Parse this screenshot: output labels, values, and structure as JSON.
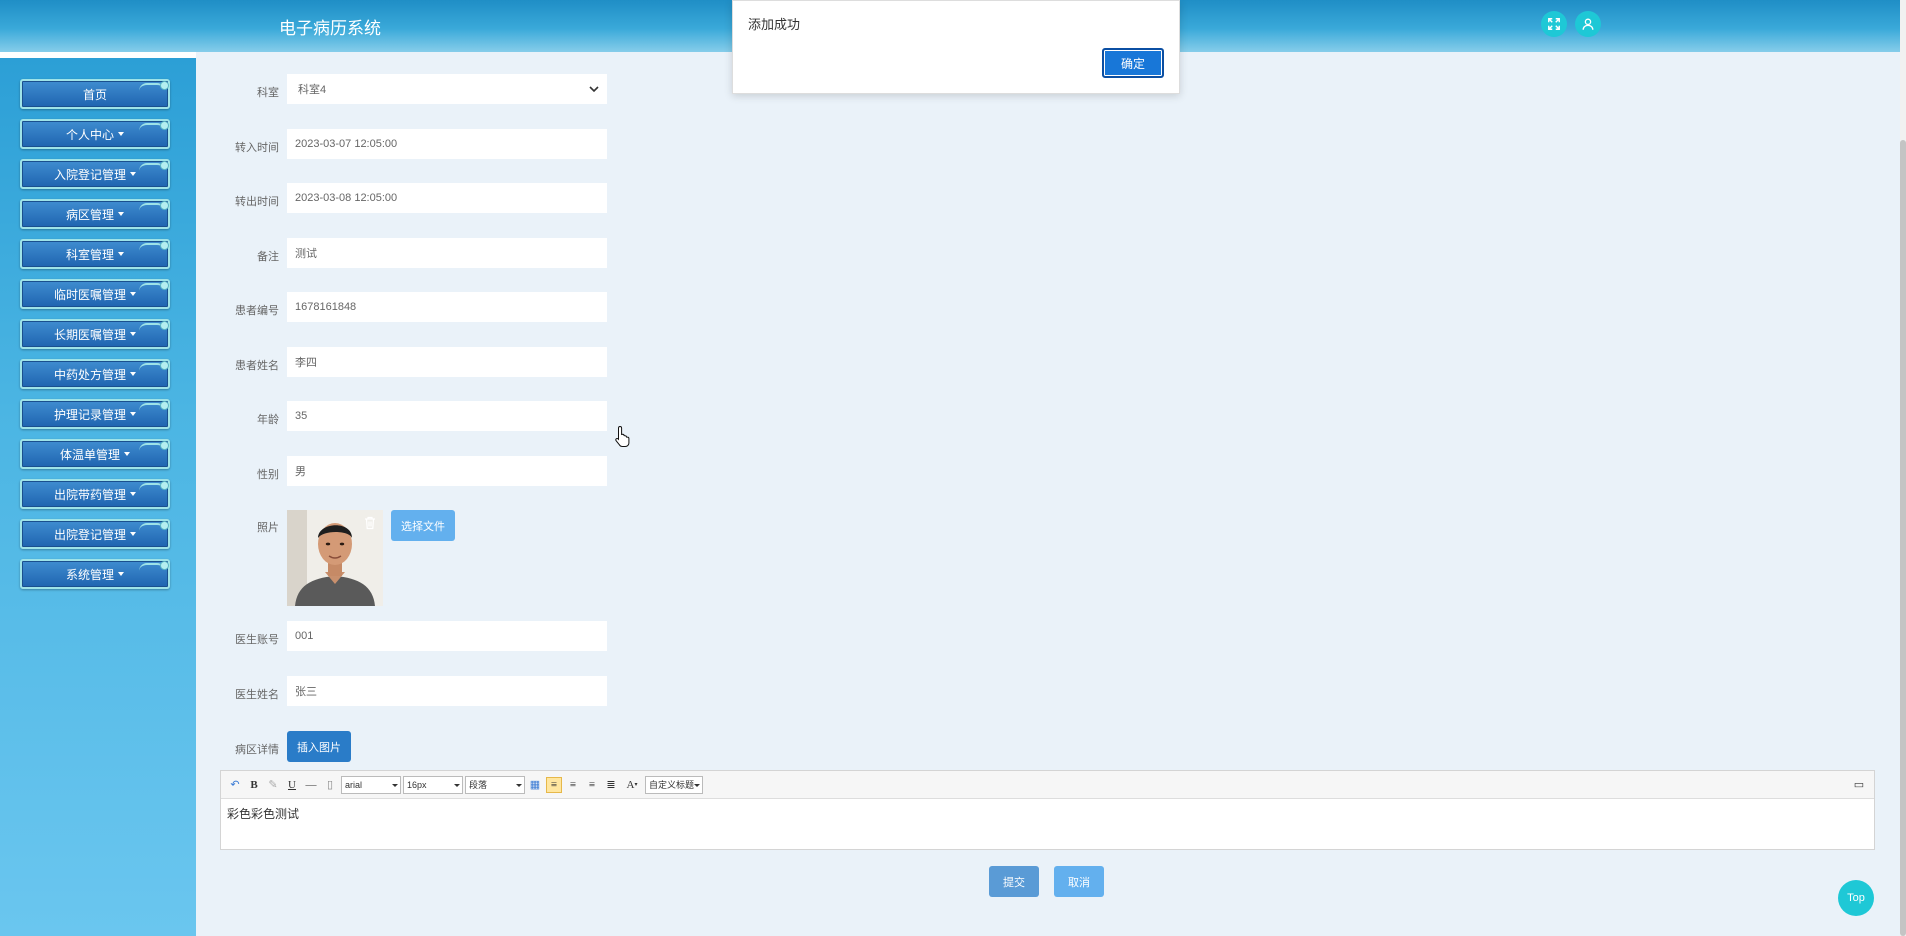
{
  "header": {
    "title": "电子病历系统",
    "fullscreen_icon": "expand-icon",
    "user_icon": "user-icon"
  },
  "sidebar": {
    "items": [
      {
        "label": "首页",
        "has_caret": false
      },
      {
        "label": "个人中心",
        "has_caret": true
      },
      {
        "label": "入院登记管理",
        "has_caret": true
      },
      {
        "label": "病区管理",
        "has_caret": true
      },
      {
        "label": "科室管理",
        "has_caret": true
      },
      {
        "label": "临时医嘱管理",
        "has_caret": true
      },
      {
        "label": "长期医嘱管理",
        "has_caret": true
      },
      {
        "label": "中药处方管理",
        "has_caret": true
      },
      {
        "label": "护理记录管理",
        "has_caret": true
      },
      {
        "label": "体温单管理",
        "has_caret": true
      },
      {
        "label": "出院带药管理",
        "has_caret": true
      },
      {
        "label": "出院登记管理",
        "has_caret": true
      },
      {
        "label": "系统管理",
        "has_caret": true
      }
    ]
  },
  "form": {
    "department": {
      "label": "科室",
      "value": "科室4"
    },
    "transfer_in": {
      "label": "转入时间",
      "value": "2023-03-07 12:05:00"
    },
    "transfer_out": {
      "label": "转出时间",
      "value": "2023-03-08 12:05:00"
    },
    "remark": {
      "label": "备注",
      "value": "测试"
    },
    "patient_no": {
      "label": "患者编号",
      "value": "1678161848"
    },
    "patient_name": {
      "label": "患者姓名",
      "value": "李四"
    },
    "age": {
      "label": "年龄",
      "value": "35"
    },
    "gender": {
      "label": "性别",
      "value": "男"
    },
    "photo": {
      "label": "照片",
      "choose_button": "选择文件"
    },
    "doctor_account": {
      "label": "医生账号",
      "value": "001"
    },
    "doctor_name": {
      "label": "医生姓名",
      "value": "张三"
    },
    "ward_detail": {
      "label": "病区详情",
      "insert_image_button": "插入图片"
    }
  },
  "editor": {
    "font_family": "arial",
    "font_size": "16px",
    "paragraph": "段落",
    "custom_heading": "自定义标题",
    "content": "彩色彩色测试"
  },
  "actions": {
    "submit": "提交",
    "cancel": "取消"
  },
  "dialog": {
    "message": "添加成功",
    "ok": "确定"
  },
  "top_button": "Top",
  "colors": {
    "accent": "#1877d8",
    "header": "#1f8ec6",
    "teal": "#1ec8d6"
  }
}
